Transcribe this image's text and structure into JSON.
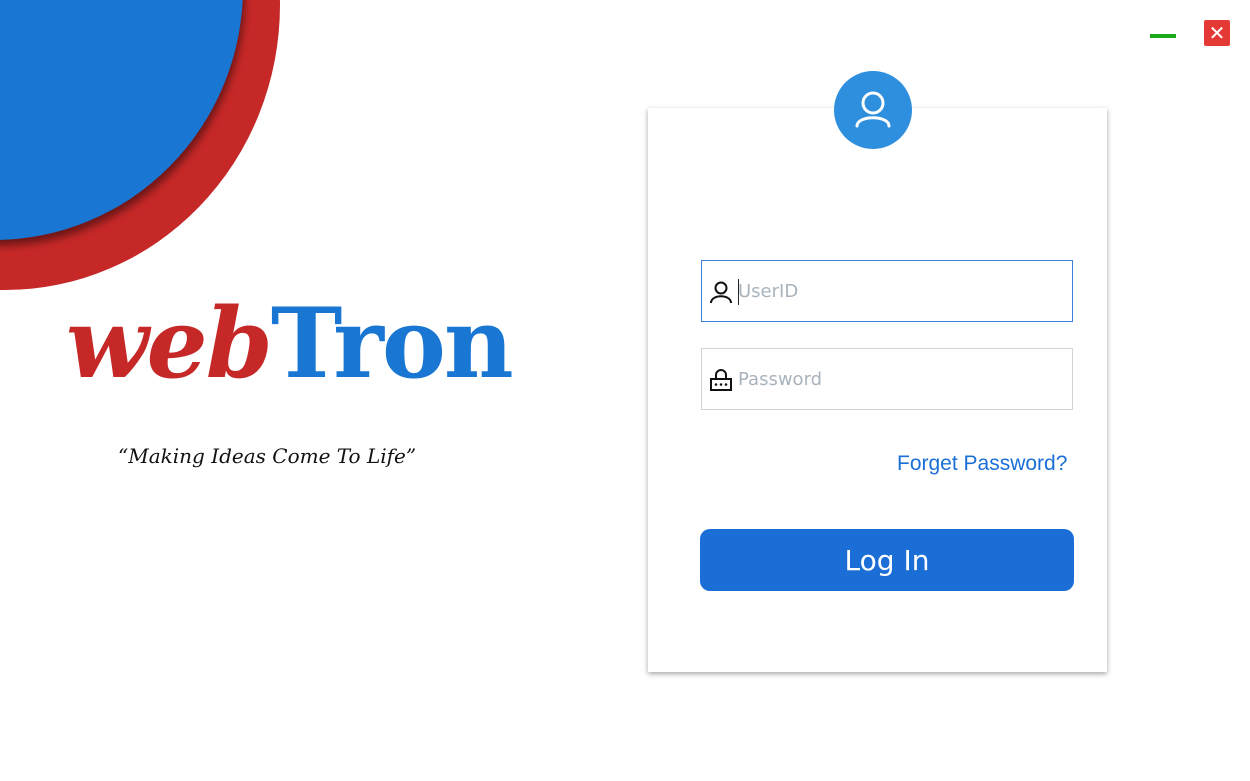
{
  "brand": {
    "name_part1": "web",
    "name_part2": "Tron",
    "tagline": "“Making Ideas Come To Life”",
    "color_red": "#c62828",
    "color_blue": "#1976d2"
  },
  "window_controls": {
    "minimize_icon": "minimize-icon",
    "close_icon": "close-icon",
    "close_glyph": "✕"
  },
  "login_form": {
    "avatar_icon": "user-icon",
    "userid_icon": "user-icon",
    "userid_placeholder": "UserID",
    "password_icon": "lock-icon",
    "password_placeholder": "Password",
    "forgot_label": "Forget Password?",
    "login_label": "Log In",
    "accent": "#1a6ed6"
  }
}
